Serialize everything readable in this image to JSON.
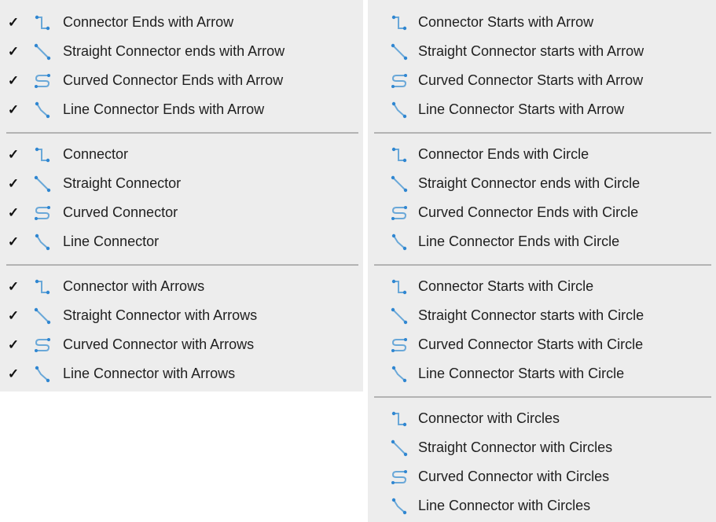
{
  "left_menu": {
    "check_glyph": "✓",
    "groups": [
      {
        "items": [
          {
            "label": "Connector Ends with Arrow",
            "icon": "elbow-connector-icon"
          },
          {
            "label": "Straight Connector ends with Arrow",
            "icon": "straight-connector-icon"
          },
          {
            "label": "Curved Connector Ends with Arrow",
            "icon": "curved-connector-icon"
          },
          {
            "label": "Line Connector Ends with Arrow",
            "icon": "line-connector-icon"
          }
        ]
      },
      {
        "items": [
          {
            "label": "Connector",
            "icon": "elbow-connector-icon"
          },
          {
            "label": "Straight Connector",
            "icon": "straight-connector-icon"
          },
          {
            "label": "Curved Connector",
            "icon": "curved-connector-icon"
          },
          {
            "label": "Line Connector",
            "icon": "line-connector-icon"
          }
        ]
      },
      {
        "items": [
          {
            "label": "Connector with Arrows",
            "icon": "elbow-connector-icon"
          },
          {
            "label": "Straight Connector with Arrows",
            "icon": "straight-connector-icon"
          },
          {
            "label": "Curved Connector with Arrows",
            "icon": "curved-connector-icon"
          },
          {
            "label": "Line Connector with Arrows",
            "icon": "line-connector-icon"
          }
        ]
      }
    ]
  },
  "right_menu": {
    "groups": [
      {
        "items": [
          {
            "label": "Connector Starts with Arrow",
            "icon": "elbow-connector-icon"
          },
          {
            "label": "Straight Connector starts with Arrow",
            "icon": "straight-connector-icon"
          },
          {
            "label": "Curved Connector Starts with Arrow",
            "icon": "curved-connector-icon"
          },
          {
            "label": "Line Connector Starts with Arrow",
            "icon": "line-connector-icon"
          }
        ]
      },
      {
        "items": [
          {
            "label": "Connector Ends with Circle",
            "icon": "elbow-connector-icon"
          },
          {
            "label": "Straight Connector ends with Circle",
            "icon": "straight-connector-icon"
          },
          {
            "label": "Curved Connector Ends with Circle",
            "icon": "curved-connector-icon"
          },
          {
            "label": "Line Connector Ends with Circle",
            "icon": "line-connector-icon"
          }
        ]
      },
      {
        "items": [
          {
            "label": "Connector Starts with Circle",
            "icon": "elbow-connector-icon"
          },
          {
            "label": "Straight Connector starts with Circle",
            "icon": "straight-connector-icon"
          },
          {
            "label": "Curved Connector Starts with Circle",
            "icon": "curved-connector-icon"
          },
          {
            "label": "Line Connector Starts with Circle",
            "icon": "line-connector-icon"
          }
        ]
      },
      {
        "items": [
          {
            "label": "Connector with Circles",
            "icon": "elbow-connector-icon"
          },
          {
            "label": "Straight Connector with Circles",
            "icon": "straight-connector-icon"
          },
          {
            "label": "Curved Connector with Circles",
            "icon": "curved-connector-icon"
          },
          {
            "label": "Line Connector with Circles",
            "icon": "line-connector-icon"
          }
        ]
      }
    ]
  },
  "colors": {
    "icon_line": "#6aa8d8",
    "icon_dot": "#2f86d1"
  }
}
